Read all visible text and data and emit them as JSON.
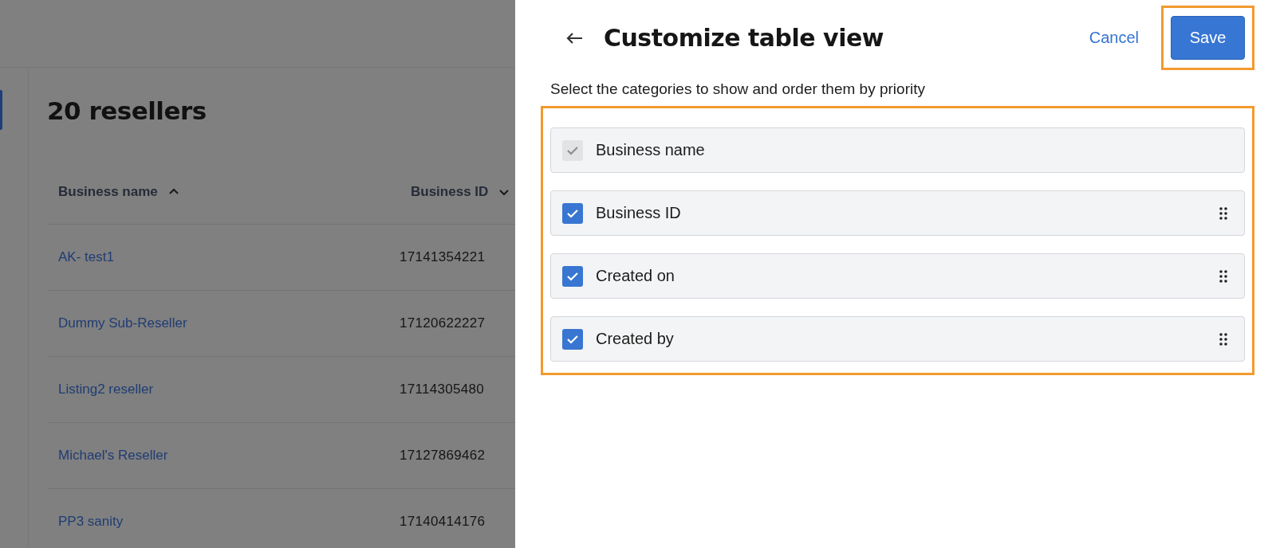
{
  "page": {
    "heading": "20 resellers",
    "columns": [
      {
        "label": "Business name",
        "sort_ascending": true
      },
      {
        "label": "Business ID",
        "sort_ascending": false
      }
    ],
    "rows": [
      {
        "name": "AK- test1",
        "id": "17141354221"
      },
      {
        "name": "Dummy Sub-Reseller",
        "id": "17120622227"
      },
      {
        "name": "Listing2 reseller",
        "id": "17114305480"
      },
      {
        "name": "Michael's Reseller",
        "id": "17127869462"
      },
      {
        "name": "PP3 sanity",
        "id": "17140414176"
      }
    ]
  },
  "panel": {
    "title": "Customize table view",
    "cancel": "Cancel",
    "save": "Save",
    "save_highlighted": true,
    "instructions": "Select the categories to show and order them by priority",
    "list_highlighted": true,
    "categories": [
      {
        "label": "Business name",
        "checked": true,
        "disabled": true,
        "draggable": false
      },
      {
        "label": "Business ID",
        "checked": true,
        "disabled": false,
        "draggable": true
      },
      {
        "label": "Created on",
        "checked": true,
        "disabled": false,
        "draggable": true
      },
      {
        "label": "Created by",
        "checked": true,
        "disabled": false,
        "draggable": true
      }
    ]
  }
}
